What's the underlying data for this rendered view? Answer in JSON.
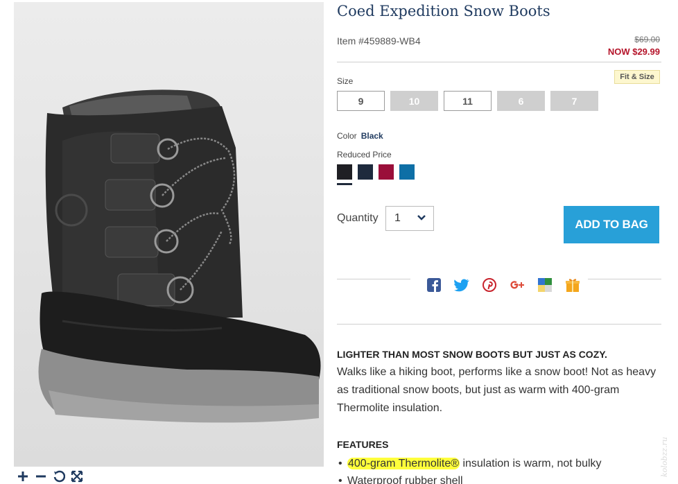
{
  "product": {
    "title": "Coed Expedition Snow Boots",
    "item_number": "Item #459889-WB4",
    "was_price": "$69.00",
    "now_price": "NOW $29.99"
  },
  "size": {
    "label": "Size",
    "fit_link": "Fit & Size",
    "options": [
      {
        "label": "9",
        "available": true
      },
      {
        "label": "10",
        "available": false
      },
      {
        "label": "11",
        "available": true
      },
      {
        "label": "6",
        "available": false
      },
      {
        "label": "7",
        "available": false
      }
    ]
  },
  "color": {
    "label": "Color",
    "selected": "Black",
    "group_label": "Reduced Price",
    "swatches": [
      "#1f1f24",
      "#1e2a3d",
      "#9a0f3a",
      "#0e6fa6"
    ]
  },
  "quantity": {
    "label": "Quantity",
    "value": "1"
  },
  "add_to_bag": "ADD TO BAG",
  "share_icons": [
    "facebook-icon",
    "twitter-icon",
    "pinterest-icon",
    "google-plus-icon",
    "delicious-icon",
    "gift-icon"
  ],
  "description": {
    "heading": "LIGHTER THAN MOST SNOW BOOTS BUT JUST AS COZY.",
    "text": "Walks like a hiking boot, performs like a snow boot! Not as heavy as traditional snow boots, but just as warm with 400-gram Thermolite insulation."
  },
  "features": {
    "heading": "FEATURES",
    "items": [
      {
        "highlight": "400-gram Thermolite®",
        "rest": " insulation is warm, not bulky"
      },
      {
        "highlight": "",
        "rest": "Waterproof rubber shell"
      }
    ]
  },
  "watermark": "kolobzz.ru"
}
